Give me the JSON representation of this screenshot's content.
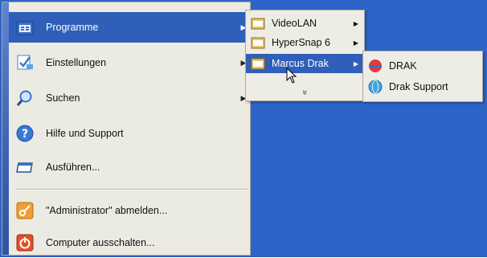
{
  "colors": {
    "desktop": "#2c64c8",
    "menu_bg": "#ecebe3",
    "highlight": "#2f5fb8"
  },
  "start_menu": {
    "items": [
      {
        "label": "Programme",
        "icon": "programs-folder-icon",
        "has_submenu": true,
        "highlighted": true
      },
      {
        "label": "Einstellungen",
        "icon": "settings-icon",
        "has_submenu": true
      },
      {
        "label": "Suchen",
        "icon": "search-icon",
        "has_submenu": true
      },
      {
        "label": "Hilfe und Support",
        "icon": "help-icon"
      },
      {
        "label": "Ausführen...",
        "icon": "run-icon"
      },
      {
        "label": "\"Administrator\" abmelden...",
        "icon": "logoff-key-icon"
      },
      {
        "label": "Computer ausschalten...",
        "icon": "power-icon"
      }
    ]
  },
  "programs_submenu": {
    "items": [
      {
        "label": "VideoLAN",
        "icon": "program-group-icon",
        "has_submenu": true
      },
      {
        "label": "HyperSnap 6",
        "icon": "program-group-icon",
        "has_submenu": true
      },
      {
        "label": "Marcus Drak",
        "icon": "program-group-icon",
        "has_submenu": true,
        "highlighted": true
      }
    ],
    "more_glyph": "»"
  },
  "drak_submenu": {
    "items": [
      {
        "label": "DRAK",
        "icon": "drak-app-icon"
      },
      {
        "label": "Drak Support",
        "icon": "globe-icon"
      }
    ]
  }
}
